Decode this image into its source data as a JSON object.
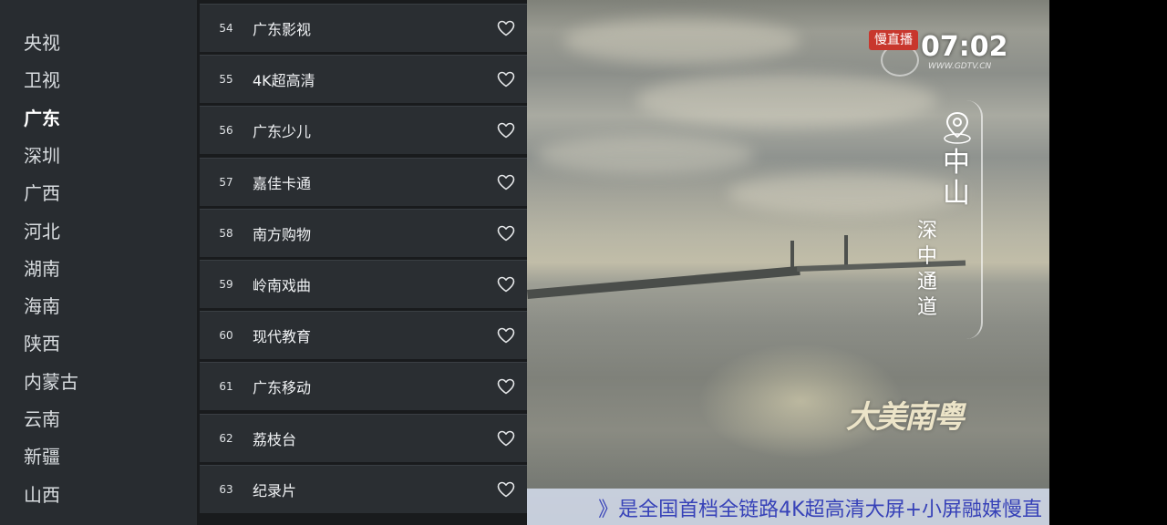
{
  "categories": {
    "partial_top": "",
    "items": [
      {
        "label": "央视"
      },
      {
        "label": "卫视"
      },
      {
        "label": "广东",
        "active": true
      },
      {
        "label": "深圳"
      },
      {
        "label": "广西"
      },
      {
        "label": "河北"
      },
      {
        "label": "湖南"
      },
      {
        "label": "海南"
      },
      {
        "label": "陕西"
      },
      {
        "label": "内蒙古"
      },
      {
        "label": "云南"
      },
      {
        "label": "新疆"
      },
      {
        "label": "山西"
      }
    ]
  },
  "channels": [
    {
      "number": "54",
      "name": "广东影视",
      "favorite_icon": "heart-outline-icon"
    },
    {
      "number": "55",
      "name": "4K超高清",
      "favorite_icon": "heart-outline-icon"
    },
    {
      "number": "56",
      "name": "广东少儿",
      "favorite_icon": "heart-outline-icon"
    },
    {
      "number": "57",
      "name": "嘉佳卡通",
      "favorite_icon": "heart-outline-icon"
    },
    {
      "number": "58",
      "name": "南方购物",
      "favorite_icon": "heart-outline-icon"
    },
    {
      "number": "59",
      "name": "岭南戏曲",
      "favorite_icon": "heart-outline-icon"
    },
    {
      "number": "60",
      "name": "现代教育",
      "favorite_icon": "heart-outline-icon"
    },
    {
      "number": "61",
      "name": "广东移动",
      "favorite_icon": "heart-outline-icon"
    },
    {
      "number": "62",
      "name": "荔枝台",
      "favorite_icon": "heart-outline-icon"
    },
    {
      "number": "63",
      "name": "纪录片",
      "favorite_icon": "heart-outline-icon"
    }
  ],
  "video": {
    "live_badge": "慢直播",
    "clock": "07:02",
    "logo_url": "WWW.GDTV.CN",
    "location_big": [
      "中",
      "山"
    ],
    "location_small": [
      "深",
      "中",
      "通",
      "道"
    ],
    "calligraphy": "大美南粤",
    "ticker": "》是全国首档全链路4K超高清大屏+小屏融媒慢直"
  },
  "colors": {
    "category_bg": "#282c30",
    "channel_row_bg": "#2a2e32",
    "live_badge_red": "#c8372d",
    "ticker_text": "#3742b8"
  }
}
